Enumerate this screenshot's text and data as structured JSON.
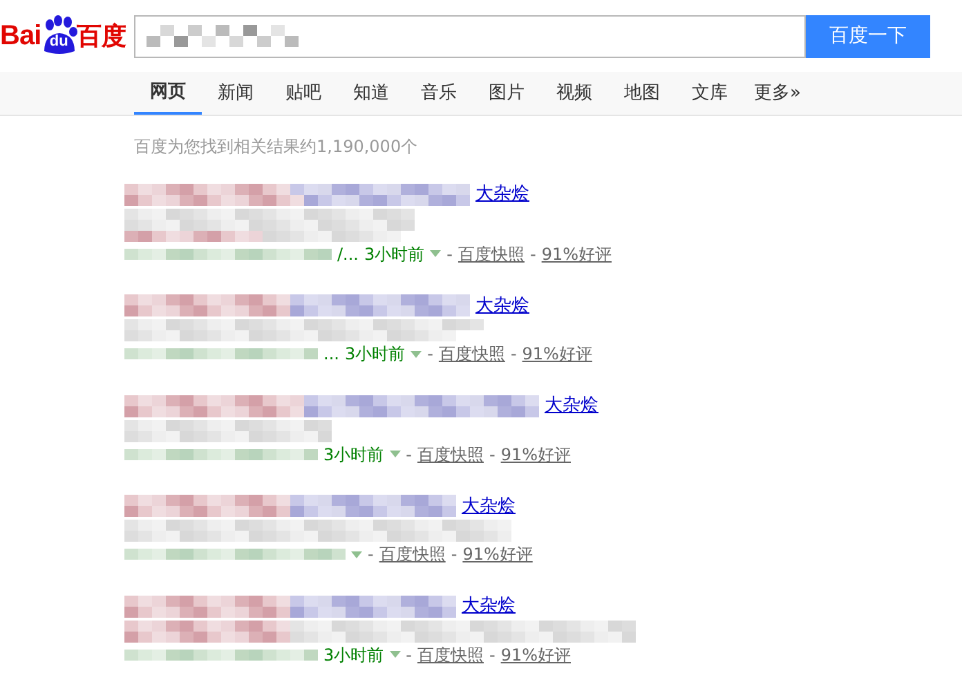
{
  "logo": {
    "left": "Bai",
    "badge": "du",
    "right": "百度"
  },
  "search": {
    "button": "百度一下"
  },
  "tabs": [
    {
      "label": "网页",
      "selected": true
    },
    {
      "label": "新闻",
      "selected": false
    },
    {
      "label": "贴吧",
      "selected": false
    },
    {
      "label": "知道",
      "selected": false
    },
    {
      "label": "音乐",
      "selected": false
    },
    {
      "label": "图片",
      "selected": false
    },
    {
      "label": "视频",
      "selected": false
    },
    {
      "label": "地图",
      "selected": false
    },
    {
      "label": "文库",
      "selected": false
    },
    {
      "label": "更多»",
      "selected": false
    }
  ],
  "meta_separator": "-",
  "result_count": "百度为您找到相关结果约1,190,000个",
  "results": [
    {
      "title": "大杂烩",
      "url_tail": "/...",
      "time": "3小时前",
      "snapshot": "百度快照",
      "rating": "91%好评"
    },
    {
      "title": "大杂烩",
      "url_tail": "...",
      "time": "3小时前",
      "snapshot": "百度快照",
      "rating": "91%好评"
    },
    {
      "title": "大杂烩",
      "time": "3小时前",
      "snapshot": "百度快照",
      "rating": "91%好评"
    },
    {
      "title": "大杂烩",
      "snapshot": "百度快照",
      "rating": "91%好评"
    },
    {
      "title": "大杂烩",
      "time": "3小时前",
      "snapshot": "百度快照",
      "rating": "91%好评"
    }
  ]
}
